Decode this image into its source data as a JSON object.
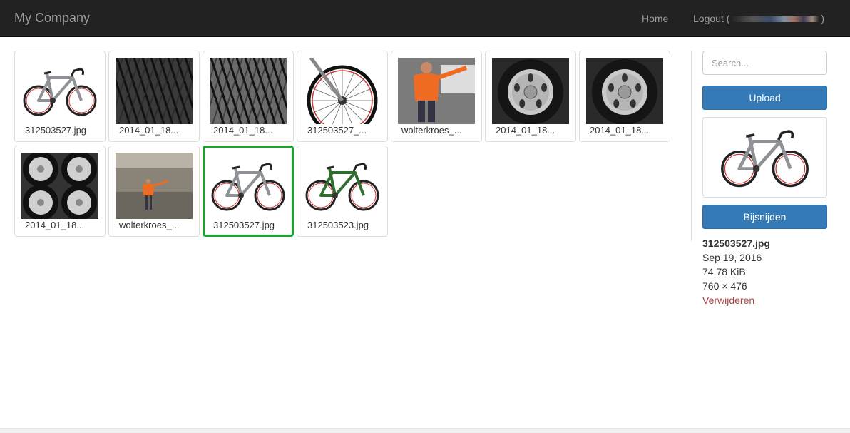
{
  "navbar": {
    "brand": "My Company",
    "home": "Home",
    "logout_prefix": "Logout (",
    "logout_suffix": ")"
  },
  "thumbnails": [
    {
      "caption": "312503527.jpg",
      "image": "bike-gray",
      "selected": false
    },
    {
      "caption": "2014_01_18...",
      "image": "tire-tread-dark",
      "selected": false
    },
    {
      "caption": "2014_01_18...",
      "image": "tire-tread-light",
      "selected": false
    },
    {
      "caption": "312503527_...",
      "image": "bike-wheel-closeup",
      "selected": false
    },
    {
      "caption": "wolterkroes_...",
      "image": "person-orange",
      "selected": false
    },
    {
      "caption": "2014_01_18...",
      "image": "steel-wheel",
      "selected": false
    },
    {
      "caption": "2014_01_18...",
      "image": "steel-wheel-2",
      "selected": false
    },
    {
      "caption": "2014_01_18...",
      "image": "four-wheels",
      "selected": false
    },
    {
      "caption": "wolterkroes_...",
      "image": "person-car-interior",
      "selected": false
    },
    {
      "caption": "312503527.jpg",
      "image": "bike-gray",
      "selected": true
    },
    {
      "caption": "312503523.jpg",
      "image": "bike-green",
      "selected": false
    }
  ],
  "sidebar": {
    "search_placeholder": "Search...",
    "upload_label": "Upload",
    "crop_label": "Bijsnijden",
    "file_name": "312503527.jpg",
    "file_date": "Sep 19, 2016",
    "file_size": "74.78 KiB",
    "file_dimensions": "760 × 476",
    "delete_label": "Verwijderen"
  },
  "colors": {
    "navbar_bg": "#222222",
    "primary_button": "#337ab7",
    "selected_border": "#1aa32a",
    "delete_link": "#a94442"
  }
}
